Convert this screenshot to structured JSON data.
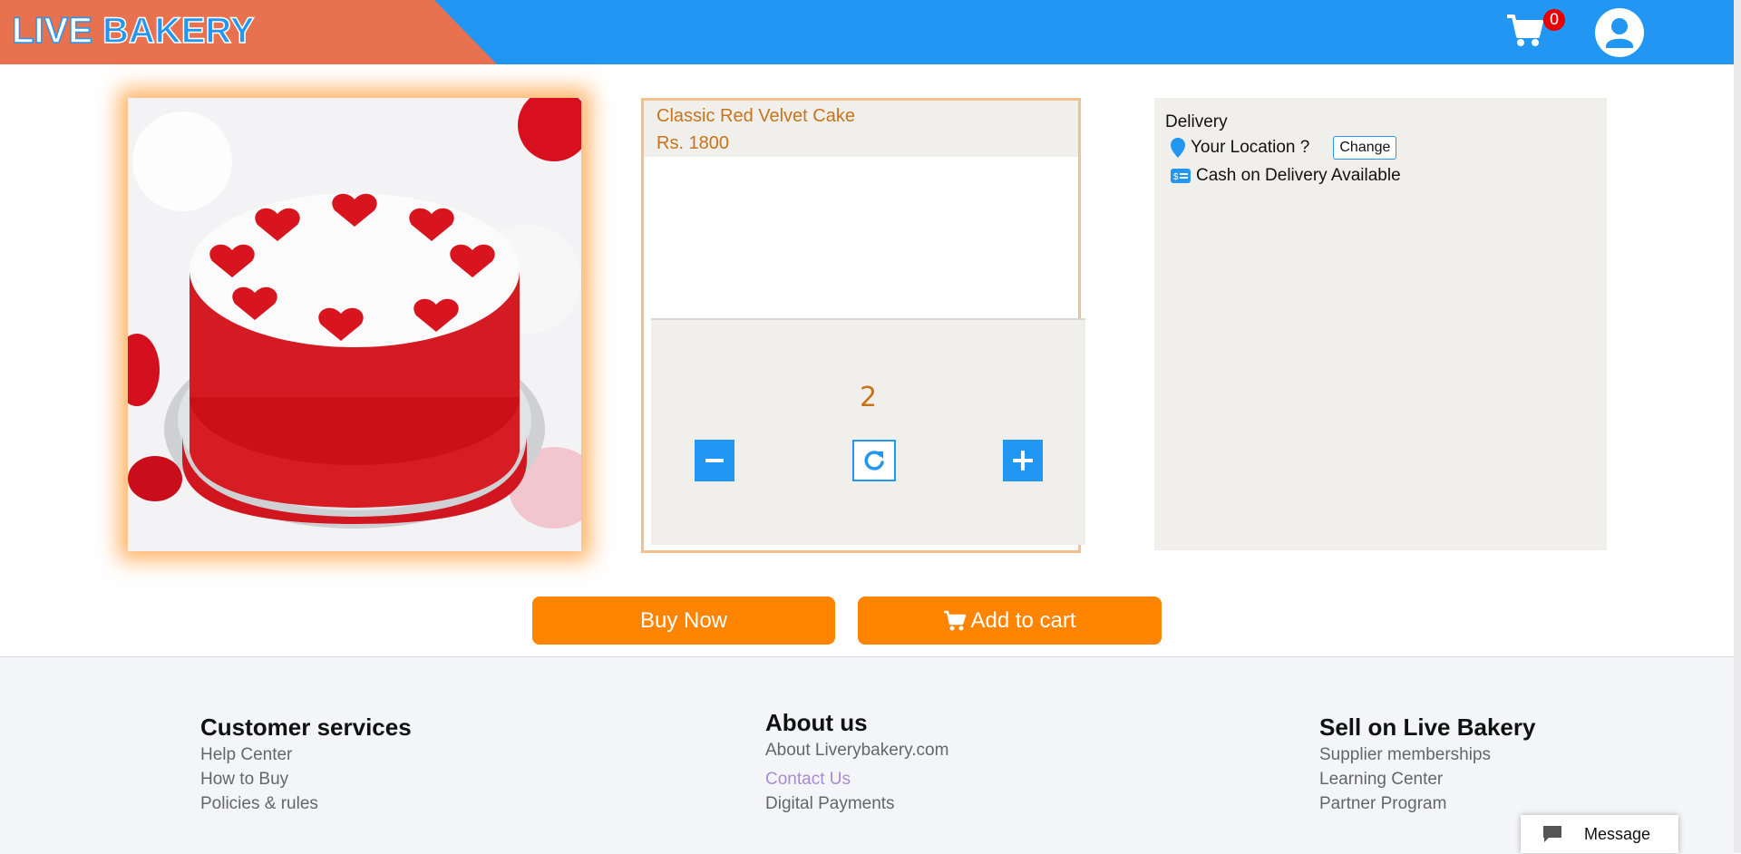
{
  "brand": {
    "word1": "LIVE",
    "word2": "BAKERY"
  },
  "header": {
    "cart_count": "0"
  },
  "product": {
    "name": "Classic Red Velvet Cake",
    "price": "Rs. 1800",
    "quantity": "2"
  },
  "delivery": {
    "title": "Delivery",
    "location_label": "Your Location ?",
    "change_label": "Change",
    "cod_label": "Cash on Delivery Available"
  },
  "actions": {
    "buy_now": "Buy Now",
    "add_to_cart": "Add to cart"
  },
  "footer": {
    "customer": {
      "title": "Customer services",
      "links": [
        "Help Center",
        "How to Buy",
        "Policies & rules"
      ]
    },
    "about": {
      "title": "About us",
      "links": [
        "About Liverybakery.com",
        "Contact Us",
        "Digital Payments"
      ]
    },
    "sell": {
      "title": "Sell on Live Bakery",
      "links": [
        "Supplier memberships",
        "Learning Center",
        "Partner Program"
      ]
    }
  },
  "message": {
    "label": "Message"
  },
  "colors": {
    "primary": "#2196f3",
    "logo_band": "#e8714f",
    "accent_orange": "#ff8400",
    "text_orange": "#c8731a",
    "panel_gray": "#f0efec",
    "badge_red": "#e60000"
  },
  "icons": [
    "cart-icon",
    "user-icon",
    "minus-icon",
    "refresh-icon",
    "plus-icon",
    "location-pin-icon",
    "cash-icon",
    "chat-icon"
  ]
}
